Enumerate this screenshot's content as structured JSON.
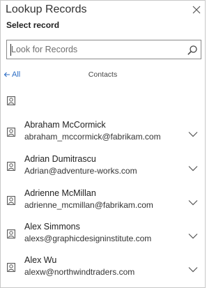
{
  "dialog": {
    "title": "Lookup Records",
    "subtitle": "Select record"
  },
  "search": {
    "placeholder": "Look for Records",
    "value": ""
  },
  "nav": {
    "back_label": "All",
    "section_label": "Contacts"
  },
  "records": [
    {
      "name": "Abraham McCormick",
      "email": "abraham_mccormick@fabrikam.com"
    },
    {
      "name": "Adrian Dumitrascu",
      "email": "Adrian@adventure-works.com"
    },
    {
      "name": "Adrienne McMillan",
      "email": "adrienne_mcmillan@fabrikam.com"
    },
    {
      "name": "Alex Simmons",
      "email": "alexs@graphicdesigninstitute.com"
    },
    {
      "name": "Alex Wu",
      "email": "alexw@northwindtraders.com"
    }
  ],
  "icons": {
    "close": "close-icon",
    "search": "search-icon",
    "back": "arrow-left-icon",
    "record": "contact-card-icon",
    "expand": "chevron-down-icon"
  },
  "colors": {
    "link": "#2b6cc4",
    "border": "#8a8a8a",
    "text": "#222222"
  }
}
